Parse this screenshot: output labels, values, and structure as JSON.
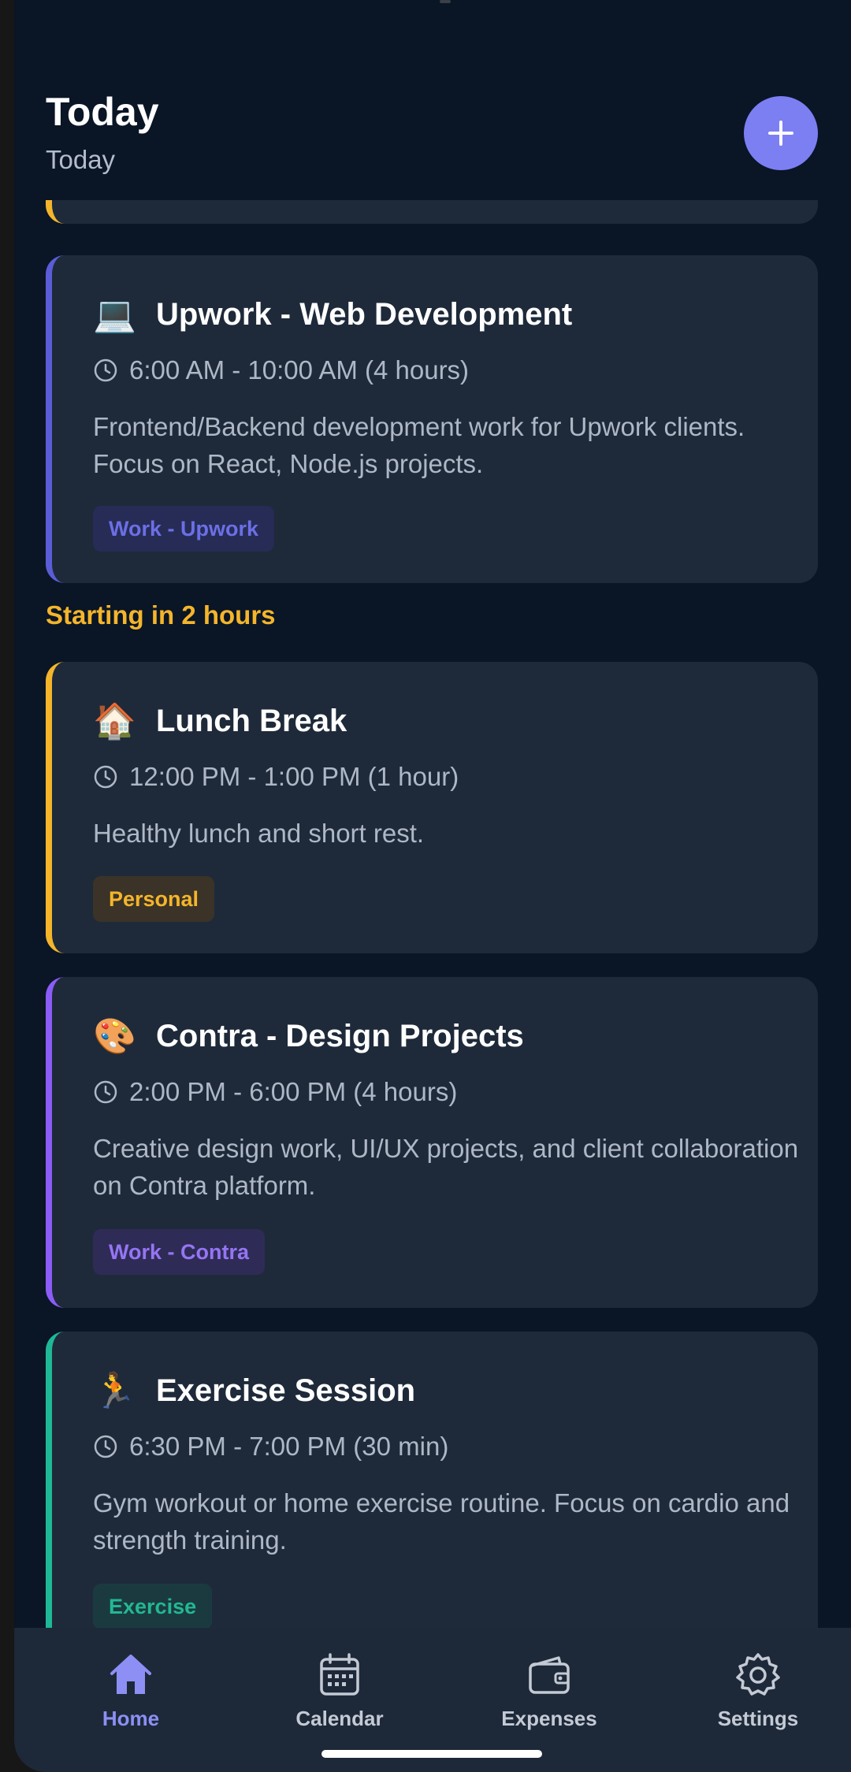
{
  "header": {
    "title": "Today",
    "subtitle": "Today"
  },
  "section_label": "Starting in 2 hours",
  "cards": [
    {
      "icon": "laptop-icon",
      "emoji": "💻",
      "title": "Upwork - Web Development",
      "time": "6:00 AM - 10:00 AM (4 hours)",
      "description": "Frontend/Backend development work for Upwork clients. Focus on React, Node.js projects.",
      "tag": "Work - Upwork",
      "accent": "#5b5dd6",
      "tag_bg": "#262c55",
      "tag_color": "#6c6fe6"
    },
    {
      "icon": "house-icon",
      "emoji": "🏠",
      "title": "Lunch Break",
      "time": "12:00 PM - 1:00 PM (1 hour)",
      "description": "Healthy lunch and short rest.",
      "tag": "Personal",
      "accent": "#f4b52b",
      "tag_bg": "#3b3328",
      "tag_color": "#f4b52b"
    },
    {
      "icon": "palette-icon",
      "emoji": "🎨",
      "title": "Contra - Design Projects",
      "time": "2:00 PM - 6:00 PM (4 hours)",
      "description": "Creative design work, UI/UX projects, and client collaboration on Contra platform.",
      "tag": "Work - Contra",
      "accent": "#8b5cf6",
      "tag_bg": "#2f2b57",
      "tag_color": "#9575f3"
    },
    {
      "icon": "running-icon",
      "emoji": "🏃",
      "title": "Exercise Session",
      "time": "6:30 PM - 7:00 PM (30 min)",
      "description": "Gym workout or home exercise routine. Focus on cardio and strength training.",
      "tag": "Exercise",
      "accent": "#1fb896",
      "tag_bg": "#1b3a40",
      "tag_color": "#22b892"
    }
  ],
  "nav": {
    "items": [
      {
        "label": "Home",
        "icon": "home-icon",
        "active": true
      },
      {
        "label": "Calendar",
        "icon": "calendar-icon",
        "active": false
      },
      {
        "label": "Expenses",
        "icon": "wallet-icon",
        "active": false
      },
      {
        "label": "Settings",
        "icon": "gear-icon",
        "active": false
      }
    ]
  },
  "colors": {
    "background": "#0a1526",
    "card": "#1e2a3a",
    "accent": "#7c7ff2",
    "nav_active": "#8d8ff5"
  }
}
